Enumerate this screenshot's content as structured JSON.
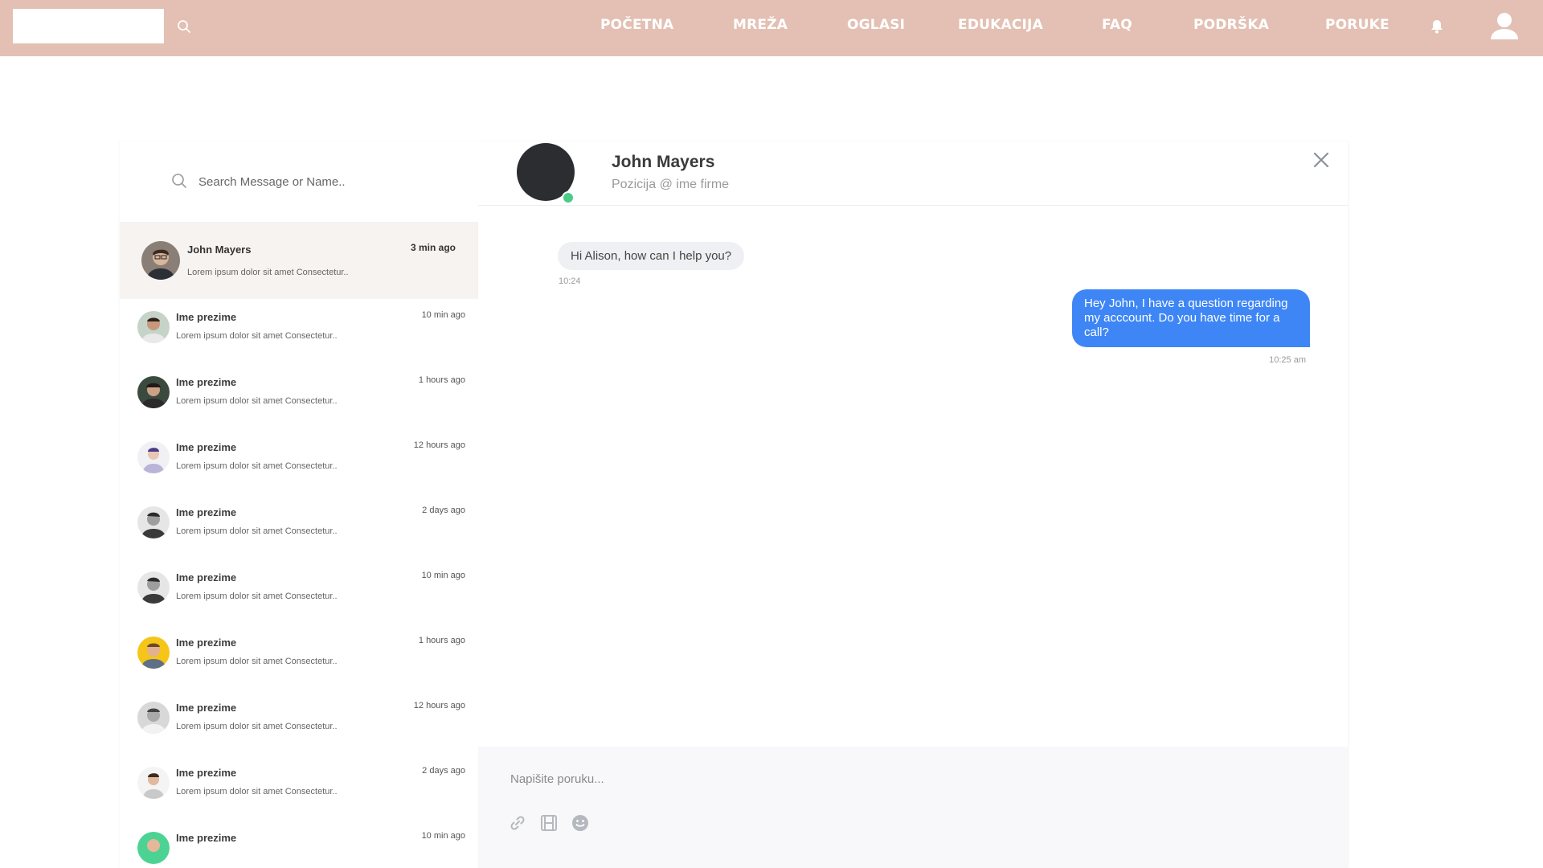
{
  "header": {
    "nav": [
      {
        "label": "POČETNA"
      },
      {
        "label": "MREŽA"
      },
      {
        "label": "OGLASI"
      },
      {
        "label": "EDUKACIJA"
      },
      {
        "label": "FAQ"
      },
      {
        "label": "PODRŠKA"
      },
      {
        "label": "PORUKE"
      }
    ],
    "icons": {
      "search": "search-icon",
      "notifications": "bell-icon",
      "profile": "user-icon"
    },
    "colors": {
      "bar": "#e3c0b3"
    }
  },
  "sidebar": {
    "search_placeholder": "Search Message or Name..",
    "active": {
      "name": "John Mayers",
      "time": "3 min ago",
      "preview": "Lorem ipsum dolor sit amet Consectetur.."
    },
    "items": [
      {
        "name": "Ime prezime",
        "time": "10 min ago",
        "preview": "Lorem ipsum dolor sit amet Consectetur.."
      },
      {
        "name": "Ime prezime",
        "time": "1 hours ago",
        "preview": "Lorem ipsum dolor sit amet Consectetur.."
      },
      {
        "name": "Ime prezime",
        "time": "12 hours ago",
        "preview": "Lorem ipsum dolor sit amet Consectetur.."
      },
      {
        "name": "Ime prezime",
        "time": "2 days ago",
        "preview": "Lorem ipsum dolor sit amet Consectetur.."
      },
      {
        "name": "Ime prezime",
        "time": "10 min ago",
        "preview": "Lorem ipsum dolor sit amet Consectetur.."
      },
      {
        "name": "Ime prezime",
        "time": "1 hours ago",
        "preview": "Lorem ipsum dolor sit amet Consectetur.."
      },
      {
        "name": "Ime prezime",
        "time": "12 hours ago",
        "preview": "Lorem ipsum dolor sit amet Consectetur.."
      },
      {
        "name": "Ime prezime",
        "time": "2 days ago",
        "preview": "Lorem ipsum dolor sit amet Consectetur.."
      },
      {
        "name": "Ime prezime",
        "time": "10 min ago",
        "preview": ""
      }
    ]
  },
  "chat": {
    "name": "John Mayers",
    "subtitle": "Pozicija @ ime firme",
    "status": "online",
    "messages": [
      {
        "direction": "in",
        "text": "Hi Alison, how can I help you?",
        "time": "10:24"
      },
      {
        "direction": "out",
        "text": "Hey John, I have a question regarding my acccount. Do you have time for a call?",
        "time": "10:25 am"
      }
    ],
    "composer_placeholder": "Napišite poruku...",
    "tools": [
      "link-icon",
      "film-icon",
      "smile-icon"
    ],
    "colors": {
      "outgoing": "#3e86f5",
      "incoming": "#eef0f3",
      "online": "#4ccb88"
    }
  }
}
